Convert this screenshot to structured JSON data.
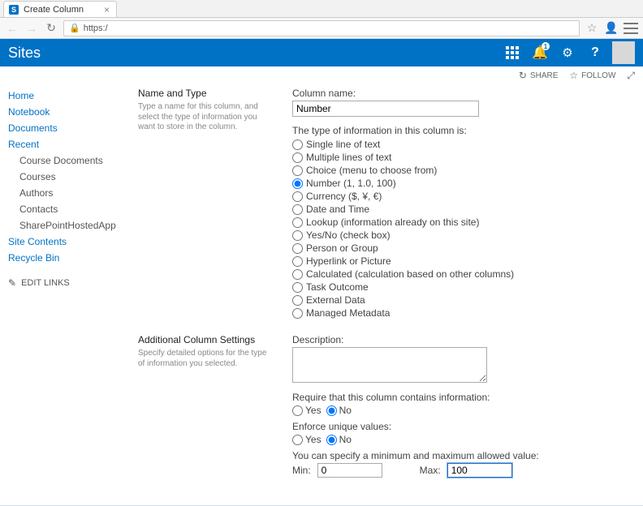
{
  "browser": {
    "tab_title": "Create Column",
    "favicon_letter": "S",
    "url_prefix": "https:/",
    "back": "←",
    "forward": "→",
    "reload": "↻",
    "star": "☆",
    "menu": "≡"
  },
  "suite": {
    "title": "Sites",
    "notif_count": "1",
    "help": "?"
  },
  "actions": {
    "share_icon": "↻",
    "share": "SHARE",
    "follow_icon": "☆",
    "follow": "FOLLOW",
    "focus_icon": "⤢"
  },
  "nav": {
    "items": [
      {
        "label": "Home"
      },
      {
        "label": "Notebook"
      },
      {
        "label": "Documents"
      },
      {
        "label": "Recent"
      }
    ],
    "recent_sub": [
      {
        "label": "Course Docoments"
      },
      {
        "label": "Courses"
      },
      {
        "label": "Authors"
      },
      {
        "label": "Contacts"
      },
      {
        "label": "SharePointHostedApp"
      }
    ],
    "tail": [
      {
        "label": "Site Contents"
      },
      {
        "label": "Recycle Bin"
      }
    ],
    "edit_links": "EDIT LINKS"
  },
  "sect1": {
    "title": "Name and Type",
    "desc": "Type a name for this column, and select the type of information you want to store in the column.",
    "col_label": "Column name:",
    "col_value": "Number",
    "type_label": "The type of information in this column is:",
    "types": [
      "Single line of text",
      "Multiple lines of text",
      "Choice (menu to choose from)",
      "Number (1, 1.0, 100)",
      "Currency ($, ¥, €)",
      "Date and Time",
      "Lookup (information already on this site)",
      "Yes/No (check box)",
      "Person or Group",
      "Hyperlink or Picture",
      "Calculated (calculation based on other columns)",
      "Task Outcome",
      "External Data",
      "Managed Metadata"
    ],
    "selected_index": 3
  },
  "sect2": {
    "title": "Additional Column Settings",
    "desc": "Specify detailed options for the type of information you selected.",
    "desc_label": "Description:",
    "desc_value": "",
    "require_label": "Require that this column contains information:",
    "require_yes": "Yes",
    "require_no": "No",
    "require_selected": "No",
    "unique_label": "Enforce unique values:",
    "unique_yes": "Yes",
    "unique_no": "No",
    "unique_selected": "No",
    "range_label": "You can specify a minimum and maximum allowed value:",
    "min_label": "Min:",
    "min_value": "0",
    "max_label": "Max:",
    "max_value": "100"
  }
}
